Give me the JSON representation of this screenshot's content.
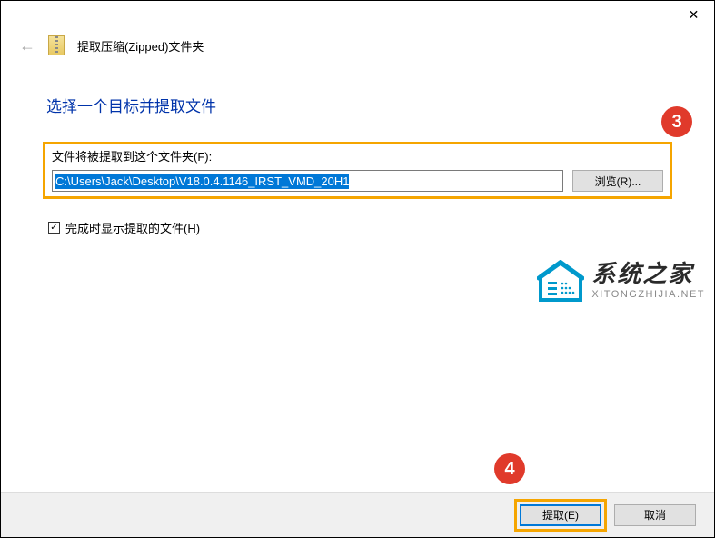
{
  "titlebar": {
    "close_glyph": "✕"
  },
  "header": {
    "back_glyph": "←",
    "title": "提取压缩(Zipped)文件夹"
  },
  "main": {
    "heading": "选择一个目标并提取文件",
    "field_label": "文件将被提取到这个文件夹(F):",
    "path_value": "C:\\Users\\Jack\\Desktop\\V18.0.4.1146_IRST_VMD_20H1",
    "browse_label": "浏览(R)..."
  },
  "checkbox": {
    "checked": true,
    "check_glyph": "✓",
    "label": "完成时显示提取的文件(H)"
  },
  "watermark": {
    "cn": "系统之家",
    "en": "XITONGZHIJIA.NET"
  },
  "footer": {
    "extract_label": "提取(E)",
    "cancel_label": "取消"
  },
  "callouts": {
    "c3": "3",
    "c4": "4"
  }
}
